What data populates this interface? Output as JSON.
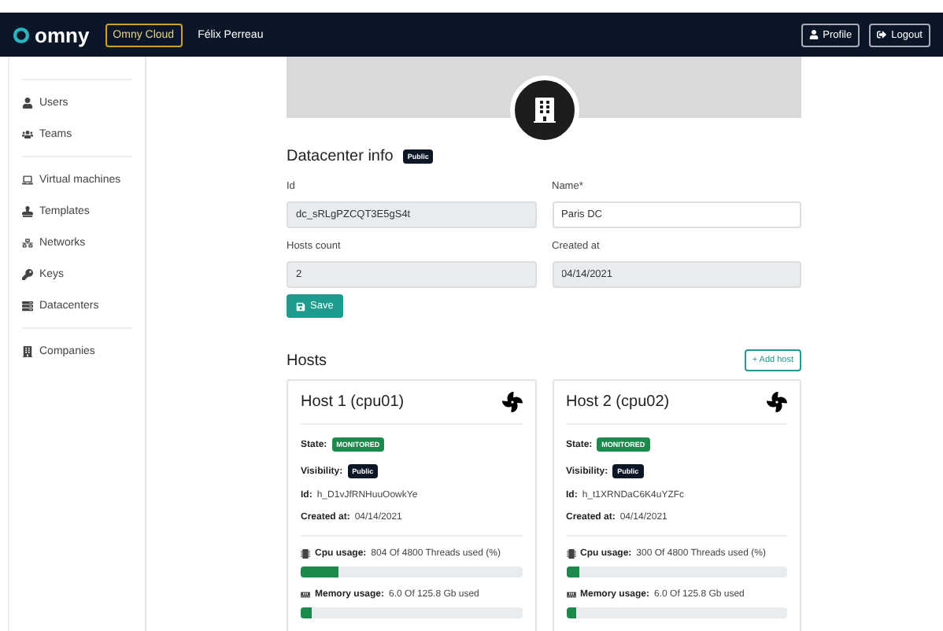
{
  "navbar": {
    "logo": "omny",
    "context": "Omny Cloud",
    "user": "Félix Perreau",
    "buttons": [
      "Profile",
      "Logout"
    ]
  },
  "sidebar": {
    "groups": [
      [
        "Users",
        "Teams"
      ],
      [
        "Virtual machines",
        "Templates",
        "Networks",
        "Keys",
        "Datacenters"
      ],
      [
        "Companies"
      ]
    ]
  },
  "datacenter_info": {
    "title": "Datacenter info",
    "badge": "Public",
    "fields": [
      {
        "label": "Id",
        "value": "dc_sRLgPZCQT3E5gS4t",
        "disabled": true
      },
      {
        "label": "Name*",
        "value": "Paris DC",
        "disabled": false
      },
      {
        "label": "Hosts count",
        "value": "2",
        "disabled": true
      },
      {
        "label": "Created at",
        "value": "04/14/2021",
        "disabled": true
      }
    ],
    "save": "Save"
  },
  "hosts": {
    "title": "Hosts",
    "add": "+ Add host",
    "cards": [
      {
        "name": "Host 1 (cpu01)",
        "state_label": "State:",
        "state": "MONITORED",
        "visibility_label": "Visibility:",
        "visibility": "Public",
        "id_label": "Id:",
        "id": "h_D1vJfRNHuuOowkYe",
        "created_label": "Created at:",
        "created": "04/14/2021",
        "usages": [
          {
            "label": "Cpu usage:",
            "text": "804 Of 4800 Threads used (%)",
            "level": 0.1675
          },
          {
            "label": "Memory usage:",
            "text": "6.0 Of 125.8 Gb used",
            "level": 0.048
          }
        ]
      },
      {
        "name": "Host 2 (cpu02)",
        "state_label": "State:",
        "state": "MONITORED",
        "visibility_label": "Visibility:",
        "visibility": "Public",
        "id_label": "Id:",
        "id": "h_t1XRNDaC6K4uYZFc",
        "created_label": "Created at:",
        "created": "04/14/2021",
        "usages": [
          {
            "label": "Cpu usage:",
            "text": "300 Of 4800 Threads used (%)",
            "level": 0.0625
          },
          {
            "label": "Memory usage:",
            "text": "6.0 Of 125.8 Gb used",
            "level": 0.048
          }
        ]
      }
    ]
  }
}
